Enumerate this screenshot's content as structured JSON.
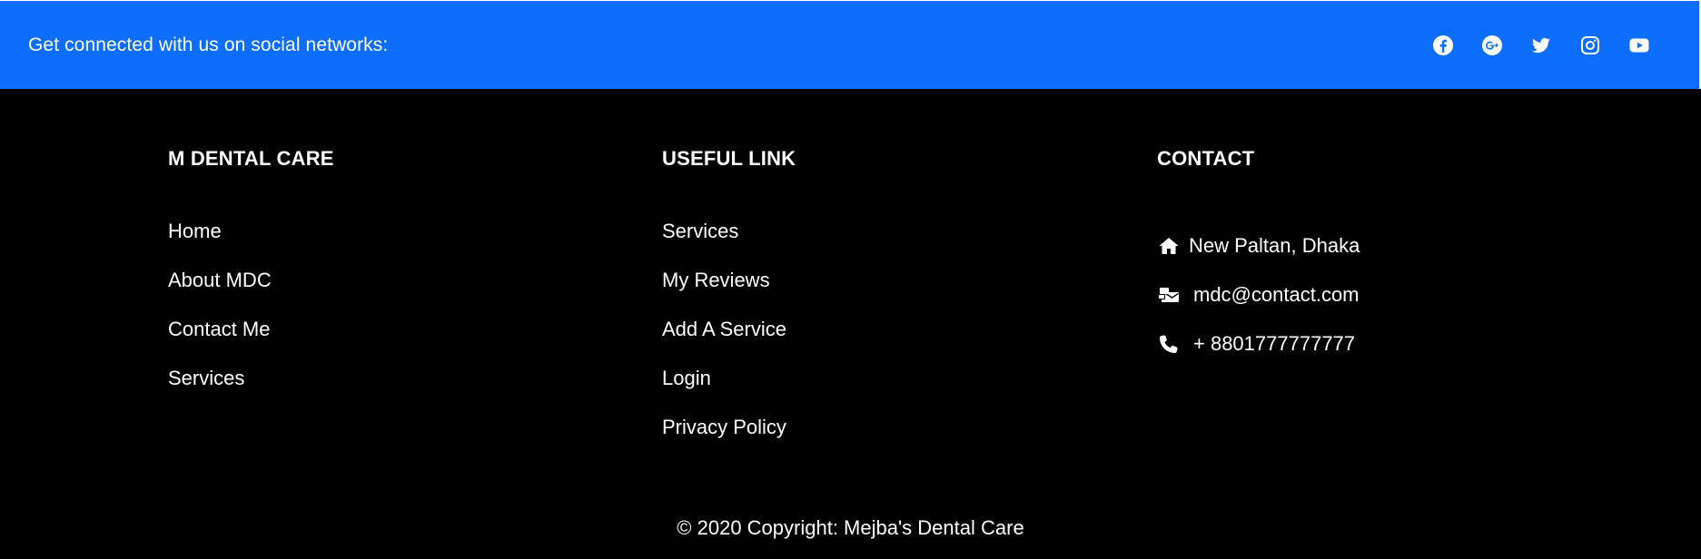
{
  "social_bar": {
    "text": "Get connected with us on social networks:",
    "background": "#0d6efd",
    "icons": [
      "facebook-icon",
      "google-icon",
      "twitter-icon",
      "instagram-icon",
      "youtube-icon"
    ]
  },
  "columns": {
    "brand": {
      "title": "M DENTAL CARE",
      "links": [
        "Home",
        "About MDC",
        "Contact Me",
        "Services"
      ]
    },
    "useful": {
      "title": "USEFUL LINK",
      "links": [
        "Services",
        "My Reviews",
        "Add A Service",
        "Login",
        "Privacy Policy"
      ]
    },
    "contact": {
      "title": "CONTACT",
      "address": "New Paltan, Dhaka",
      "email": "mdc@contact.com",
      "phone": "+ 8801777777777"
    }
  },
  "copyright": "© 2020 Copyright: Mejba's Dental Care"
}
